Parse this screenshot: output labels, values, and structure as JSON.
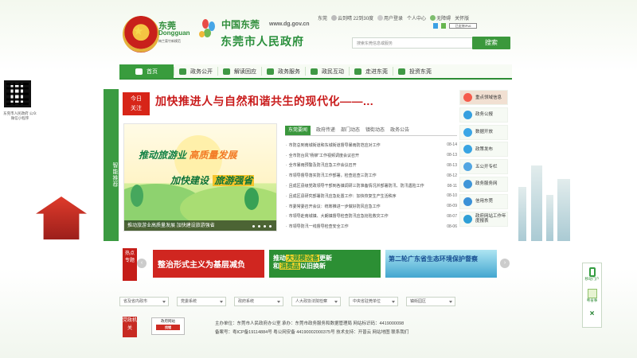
{
  "header": {
    "city_logo_cn": "东莞",
    "city_logo_en": "Dongguan",
    "city_logo_sub": "梅兰菊竹新模范",
    "brand_cn": "中国东莞",
    "brand_url": "www.dg.gov.cn",
    "gov_title": "东莞市人民政府",
    "top": {
      "city": "东莞",
      "weather": "云到晴 22到30度",
      "login": "用户登录",
      "personal": "个人中心",
      "accessible": "无障碍",
      "care": "关怀版",
      "ipv6": "IPv6",
      "ipv6_label": "已支持IPv6"
    },
    "search_placeholder": "搜索东莞信息或服务",
    "search_button": "搜索"
  },
  "nav": [
    {
      "label": "首页",
      "icon": "home-icon"
    },
    {
      "label": "政务公开",
      "icon": "monitor-icon"
    },
    {
      "label": "解读回应",
      "icon": "book-icon"
    },
    {
      "label": "政务服务",
      "icon": "service-icon"
    },
    {
      "label": "政民互动",
      "icon": "chat-icon"
    },
    {
      "label": "走进东莞",
      "icon": "flag-icon"
    },
    {
      "label": "投资东莞",
      "icon": "money-icon"
    }
  ],
  "left_qr": {
    "caption": "东莞市人民政府\n公众微信小程序"
  },
  "side_tab": "智能推荐",
  "headline": {
    "tag_line1": "今日",
    "tag_line2": "关注",
    "text": "加快推进人与自然和谐共生的现代化——..."
  },
  "banner": {
    "line1_a": "推动旅游业",
    "line1_b": "高质量发展",
    "line2_a": "加快建设",
    "line2_b": "旅游强省",
    "caption": "推动旅游业高质量发展 加快建设旅游强省"
  },
  "news_tabs": [
    "东莞要闻",
    "政府传递",
    "部门动态",
    "镇街动态",
    "政务公告"
  ],
  "news": [
    {
      "title": "市防总到南城街道和东城街道督导暴雨防范应对工作",
      "date": "08-14"
    },
    {
      "title": "全市防台风“杨柳”工作视频调度会议召开",
      "date": "08-13"
    },
    {
      "title": "全市暴雨预警及防汛应急工作会议召开",
      "date": "08-13"
    },
    {
      "title": "市领导督导落实防汛工作部署，检查巡查三防工作",
      "date": "08-12"
    },
    {
      "title": "且成区县级党政领导干部到各镇调研三防准备情况并部署防汛、防汛遇险工作",
      "date": "08-11"
    },
    {
      "title": "且成区县研究部署防汛应急处置工作：加快恢复生产生活秩序",
      "date": "08-10"
    },
    {
      "title": "市委常委召开会议：统筹推进一步做好防风应急工作",
      "date": "08-09"
    },
    {
      "title": "市领导赴南城镇、大朗镇督导检查防汛应急抢险救灾工作",
      "date": "08-07"
    },
    {
      "title": "市领导防汛一线督导检查安全工作",
      "date": "08-06"
    }
  ],
  "right_services": [
    {
      "label": "重点领域信息",
      "icon": "list-icon",
      "color": "#f55b4b"
    },
    {
      "label": "政务公报",
      "icon": "document-icon",
      "color": "#36a0df"
    },
    {
      "label": "数据开放",
      "icon": "open-data-icon",
      "color": "#3ba6e6"
    },
    {
      "label": "政策发布",
      "icon": "chart-icon",
      "color": "#38a4e2"
    },
    {
      "label": "五公开专栏",
      "icon": "star-icon",
      "color": "#52a6e2"
    },
    {
      "label": "政务服务网",
      "icon": "service-icon",
      "color": "#3f96d8"
    },
    {
      "label": "信用东莞",
      "icon": "credit-icon",
      "color": "#3b91d7"
    },
    {
      "label": "政府网站工作年度报表",
      "icon": "report-icon",
      "color": "#2e9fd6"
    }
  ],
  "special": {
    "label_line1": "热点",
    "label_line2": "专题"
  },
  "special_cards": [
    {
      "title": "整治形式主义为基层减负"
    },
    {
      "title_part1": "推动",
      "title_part2": "大规模设备",
      "title_part3": "更新",
      "title_part4": "和",
      "title_part5": "消费品",
      "title_part6": "以旧换新"
    },
    {
      "title": "第二轮广东省生态环境保护督察"
    }
  ],
  "links": [
    "省及省内政市",
    "党委系统",
    "政府系统",
    "人大政协法院检察",
    "中央省驻莞单位",
    "镇街园区"
  ],
  "footer": {
    "badge1": "党政机关",
    "badge2_title": "政府网站",
    "badge2_sub": "找错",
    "line1": "主办单位：东莞市人民政府办公室  承办：东莞市政务服务和数据管理局  网站标识码：4419000098",
    "line2": "备案号：粤ICP备19114884号  粤公网安备 44190002000375号  技术支持：开普云  网站地图  联系我们"
  },
  "floating": {
    "mobile": "移动门户",
    "app": "粤省事"
  }
}
